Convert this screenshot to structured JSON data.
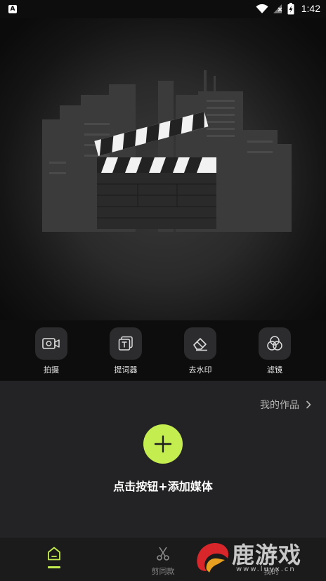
{
  "status_bar": {
    "time": "1:42",
    "left_icon_letter": "A"
  },
  "tools": [
    {
      "label": "拍摄",
      "icon": "video-camera-icon"
    },
    {
      "label": "提词器",
      "icon": "teleprompter-icon"
    },
    {
      "label": "去水印",
      "icon": "eraser-icon"
    },
    {
      "label": "滤镜",
      "icon": "filter-icon"
    }
  ],
  "panel": {
    "my_works": "我的作品",
    "add_media": "点击按钮+添加媒体"
  },
  "nav": [
    {
      "label": "",
      "icon": "home-icon",
      "active": true
    },
    {
      "label": "剪同款",
      "icon": "scissors-icon",
      "active": false
    },
    {
      "label": "我的",
      "icon": "user-icon",
      "active": false
    }
  ],
  "watermark": {
    "text": "鹿游戏",
    "url": "www.luyx.cn"
  },
  "colors": {
    "accent": "#c4ee50",
    "background": "#0d0d0d",
    "panel": "#232325"
  }
}
